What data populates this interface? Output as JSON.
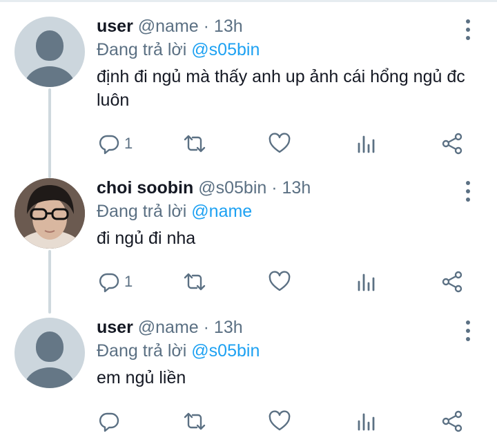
{
  "tweets": [
    {
      "name": "user",
      "handle": "@name",
      "dot": "·",
      "time": "13h",
      "replying_prefix": "Đang trả lời",
      "replying_to": "@s05bin",
      "text": "định đi ngủ mà thấy anh up ảnh cái hổng ngủ đc luôn",
      "reply_count": "1",
      "avatar": "default-avatar"
    },
    {
      "name": "choi soobin",
      "handle": "@s05bin",
      "dot": "·",
      "time": "13h",
      "replying_prefix": "Đang trả lời",
      "replying_to": "@name",
      "text": "đi ngủ đi nha",
      "reply_count": "1",
      "avatar": "profile-photo"
    },
    {
      "name": "user",
      "handle": "@name",
      "dot": "·",
      "time": "13h",
      "replying_prefix": "Đang trả lời",
      "replying_to": "@s05bin",
      "text": "em ngủ liền",
      "reply_count": "",
      "avatar": "default-avatar"
    }
  ],
  "icons": {
    "reply": "reply-icon",
    "retweet": "retweet-icon",
    "like": "heart-icon",
    "analytics": "analytics-icon",
    "share": "share-icon",
    "more": "more-vertical-icon"
  },
  "colors": {
    "accent": "#1da1f2",
    "secondary_text": "#5b7083",
    "primary_text": "#141823",
    "thread_line": "#cfd9de",
    "avatar_bg": "#ccd6dd"
  }
}
